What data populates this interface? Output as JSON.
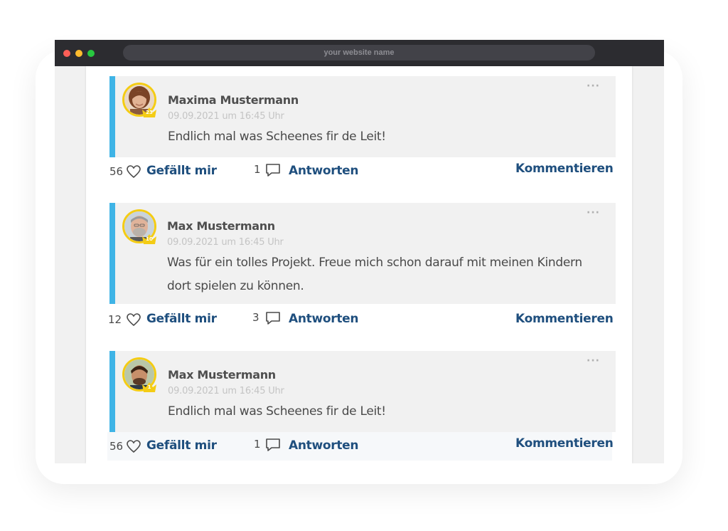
{
  "browser": {
    "address": "your website name",
    "colors": {
      "titlebar": "#2c2c30",
      "close": "#fe5f57",
      "minimize": "#febc2e",
      "maximize": "#28c840"
    }
  },
  "colors": {
    "accent_border": "#3fb4e6",
    "link": "#1f4f7e",
    "avatar_ring": "#f4cc14"
  },
  "comments": [
    {
      "author": "Maxima Mustermann",
      "date": "09.09.2021 um 16:45 Uhr",
      "text": "Endlich mal was Scheenes fir de Leit!",
      "badge": "23",
      "more": "···",
      "likes": "56",
      "like_label": "Gefällt mir",
      "replies": "1",
      "reply_label": "Antworten",
      "comment_label": "Kommentieren"
    },
    {
      "author": "Max Mustermann",
      "date": "09.09.2021 um 16:45 Uhr",
      "text_line1": "Was für ein tolles Projekt. Freue mich schon darauf mit meinen Kindern",
      "text_line2": "dort spielen zu können.",
      "badge": "10",
      "more": "···",
      "likes": "12",
      "like_label": "Gefällt mir",
      "replies": "3",
      "reply_label": "Antworten",
      "comment_label": "Kommentieren"
    },
    {
      "author": "Max Mustermann",
      "date": "09.09.2021 um 16:45 Uhr",
      "text": "Endlich mal was Scheenes fir de Leit!",
      "badge": "1",
      "more": "···",
      "likes": "56",
      "like_label": "Gefällt mir",
      "replies": "1",
      "reply_label": "Antworten",
      "comment_label": "Kommentieren"
    }
  ]
}
